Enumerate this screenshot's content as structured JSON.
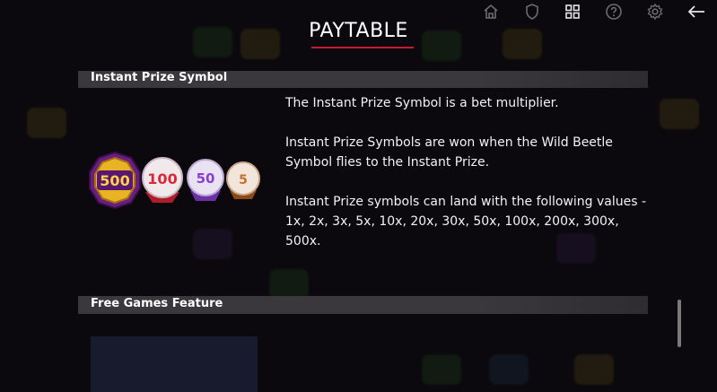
{
  "header": {
    "title": "PAYTABLE",
    "icons": [
      "home-icon",
      "shield-icon",
      "grid-icon",
      "help-icon",
      "settings-icon",
      "back-arrow-icon"
    ]
  },
  "sections": [
    {
      "heading": "Instant Prize Symbol",
      "paragraphs": [
        "The Instant Prize Symbol is a bet multiplier.",
        "Instant Prize Symbols are won when the Wild Beetle Symbol flies to the Instant Prize.",
        "Instant Prize symbols can land with the following values - 1x, 2x, 3x, 5x, 10x, 20x, 30x, 50x, 100x, 200x, 300x, 500x."
      ],
      "symbols": [
        {
          "label": "500",
          "color": "#e8b423"
        },
        {
          "label": "100",
          "color": "#d8283a"
        },
        {
          "label": "50",
          "color": "#8a3fd1"
        },
        {
          "label": "5",
          "color": "#c76e2a"
        }
      ]
    },
    {
      "heading": "Free Games Feature"
    }
  ],
  "colors": {
    "background": "#0b090d",
    "accent_underline": "#c61c32",
    "section_bar": "#3a383c"
  }
}
